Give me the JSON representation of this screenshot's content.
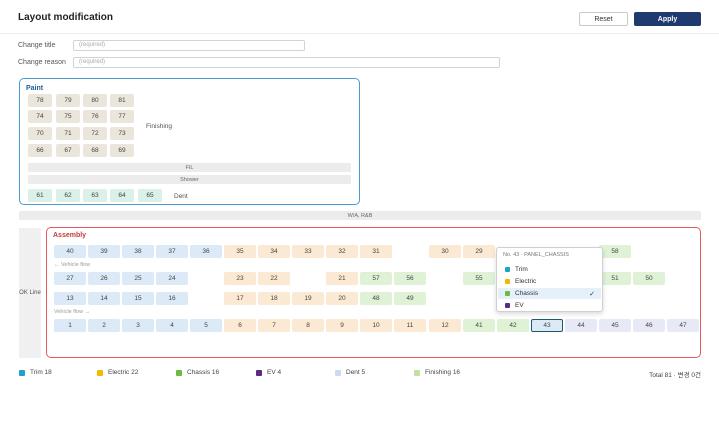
{
  "header": {
    "title": "Layout modification",
    "reset_label": "Reset",
    "apply_label": "Apply"
  },
  "form": {
    "change_title_label": "Change title",
    "change_title_placeholder": "(required)",
    "change_reason_label": "Change reason",
    "change_reason_placeholder": "(required)"
  },
  "paint": {
    "title": "Paint",
    "rows": [
      [
        "78",
        "79",
        "80",
        "81"
      ],
      [
        "74",
        "75",
        "76",
        "77"
      ],
      [
        "70",
        "71",
        "72",
        "73"
      ],
      [
        "66",
        "67",
        "68",
        "69"
      ]
    ],
    "finishing_label": "Finishing",
    "fil_label": "FIL",
    "shower_label": "Shower",
    "dent_cells": [
      "61",
      "62",
      "63",
      "64",
      "65"
    ],
    "dent_label": "Dent"
  },
  "wa_label": "W/A, R&B",
  "assembly": {
    "ok_line_label": "OK Line",
    "title": "Assembly",
    "flow_left": "← Vehicle flow",
    "flow_right": "Vehicle flow →",
    "row1": [
      "40",
      "39",
      "38",
      "37",
      "36",
      "35",
      "34",
      "33",
      "32",
      "31",
      "30",
      "29",
      "58"
    ],
    "row2": [
      "27",
      "26",
      "25",
      "24",
      "23",
      "22",
      "21",
      "57",
      "56",
      "55",
      "51",
      "50"
    ],
    "row3": [
      "13",
      "14",
      "15",
      "16",
      "17",
      "18",
      "19",
      "20",
      "48",
      "49"
    ],
    "row4": [
      "1",
      "2",
      "3",
      "4",
      "5",
      "6",
      "7",
      "8",
      "9",
      "10",
      "11",
      "12",
      "41",
      "42",
      "43",
      "44",
      "45",
      "46",
      "47"
    ]
  },
  "dropdown": {
    "header": "No. 43 · PANEL_CHASSIS",
    "options": [
      {
        "label": "Trim",
        "color": "#1fa3c9"
      },
      {
        "label": "Electric",
        "color": "#f5b800"
      },
      {
        "label": "Chassis",
        "color": "#6cba3e",
        "selected": true
      },
      {
        "label": "EV",
        "color": "#5b2a86"
      }
    ],
    "check": "✓"
  },
  "legend": [
    {
      "label": "Trim 18",
      "color": "#1fa3c9"
    },
    {
      "label": "Electric 22",
      "color": "#f5b800"
    },
    {
      "label": "Chassis 16",
      "color": "#6cba3e"
    },
    {
      "label": "EV 4",
      "color": "#5b2a86"
    },
    {
      "label": "Dent 5",
      "color": "#c7dcf2"
    },
    {
      "label": "Finishing 16",
      "color": "#bfe2a1"
    }
  ],
  "total": "Total 81 · 변경 0건"
}
